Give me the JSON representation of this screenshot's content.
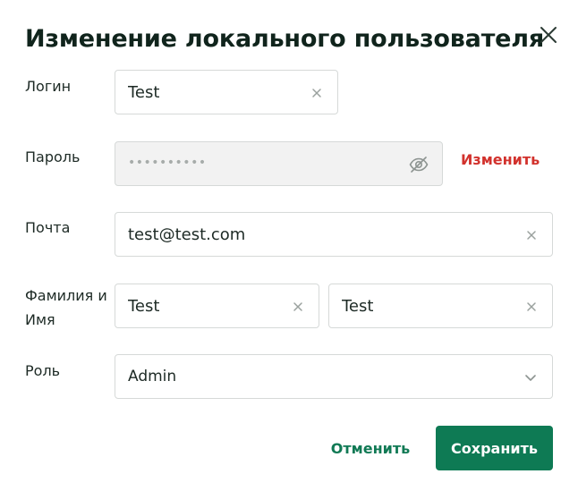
{
  "dialog": {
    "title": "Изменение локального пользователя"
  },
  "form": {
    "login": {
      "label": "Логин",
      "value": "Test"
    },
    "password": {
      "label": "Пароль",
      "masked_value": "••••••••••",
      "change_link": "Изменить"
    },
    "email": {
      "label": "Почта",
      "value": "test@test.com"
    },
    "name": {
      "label_line1": "Фамилия и",
      "label_line2": "Имя",
      "last_name": "Test",
      "first_name": "Test"
    },
    "role": {
      "label": "Роль",
      "value": "Admin"
    }
  },
  "actions": {
    "cancel_label": "Отменить",
    "save_label": "Сохранить"
  },
  "colors": {
    "primary": "#0e7a54",
    "danger_link": "#d2322d",
    "border": "#d6d9d8",
    "disabled_bg": "#f2f2f2"
  },
  "icons": [
    "close-icon",
    "clear-icon",
    "eye-slash-icon",
    "chevron-down-icon"
  ]
}
